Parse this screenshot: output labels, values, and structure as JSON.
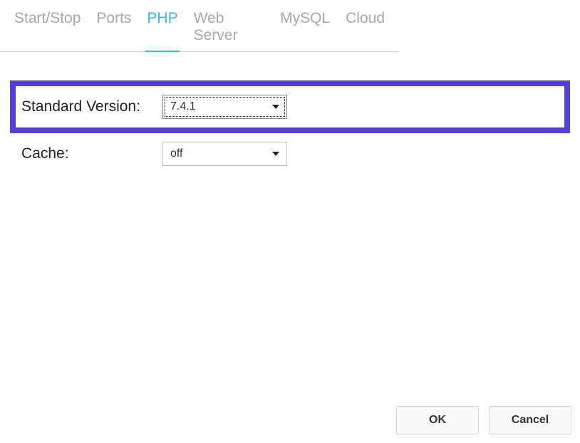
{
  "tabs": {
    "items": [
      {
        "label": "Start/Stop"
      },
      {
        "label": "Ports"
      },
      {
        "label": "PHP"
      },
      {
        "label": "Web Server"
      },
      {
        "label": "MySQL"
      },
      {
        "label": "Cloud"
      }
    ],
    "activeIndex": 2
  },
  "form": {
    "standardVersion": {
      "label": "Standard Version:",
      "value": "7.4.1"
    },
    "cache": {
      "label": "Cache:",
      "value": "off"
    }
  },
  "buttons": {
    "ok": "OK",
    "cancel": "Cancel"
  }
}
